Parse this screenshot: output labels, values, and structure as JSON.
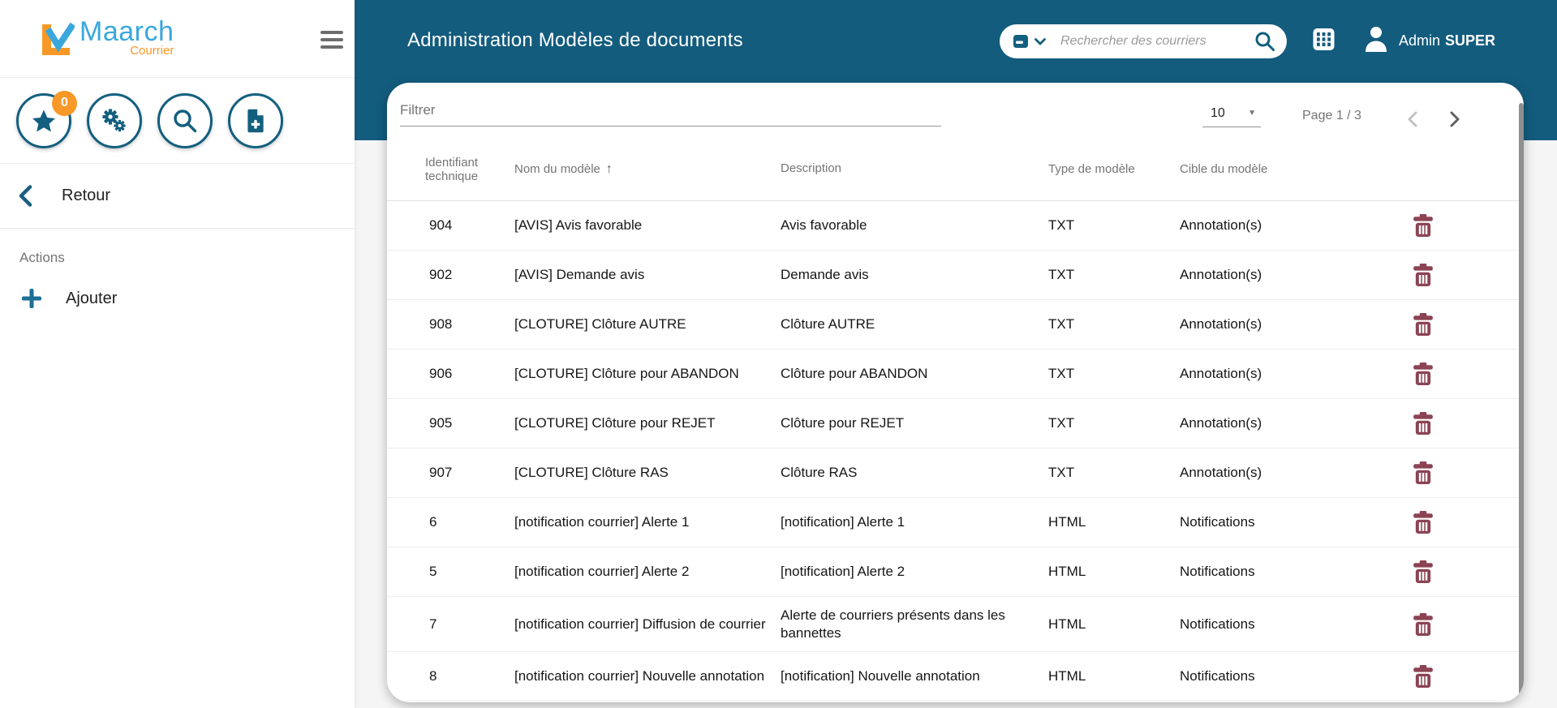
{
  "header": {
    "title": "Administration Modèles de documents",
    "search_placeholder": "Rechercher des courriers",
    "user_name": "Admin",
    "user_name_bold": "SUPER"
  },
  "sidebar": {
    "logo_text": "Maarch",
    "logo_subtext": "Courrier",
    "favorites_badge": "0",
    "back_label": "Retour",
    "actions_label": "Actions",
    "add_label": "Ajouter"
  },
  "toolbar": {
    "filter_placeholder": "Filtrer",
    "page_size": "10",
    "page_info": "Page 1 / 3"
  },
  "icons": {
    "sort_asc_glyph": "↑",
    "caret_down_glyph": "▼"
  },
  "colors": {
    "accent_teal": "#135c7e",
    "icon_teal": "#135f7f",
    "orange": "#f79827",
    "logo_blue": "#3aa7dd",
    "delete_red": "#8c4353"
  },
  "table": {
    "headers": [
      "Identifiant technique",
      "Nom du modèle",
      "Description",
      "Type de modèle",
      "Cible du modèle"
    ],
    "rows": [
      {
        "id": "904",
        "name": "[AVIS] Avis favorable",
        "description": "Avis favorable",
        "type": "TXT",
        "target": "Annotation(s)"
      },
      {
        "id": "902",
        "name": "[AVIS] Demande avis",
        "description": "Demande avis",
        "type": "TXT",
        "target": "Annotation(s)"
      },
      {
        "id": "908",
        "name": "[CLOTURE] Clôture AUTRE",
        "description": "Clôture AUTRE",
        "type": "TXT",
        "target": "Annotation(s)"
      },
      {
        "id": "906",
        "name": "[CLOTURE] Clôture pour ABANDON",
        "description": "Clôture pour ABANDON",
        "type": "TXT",
        "target": "Annotation(s)"
      },
      {
        "id": "905",
        "name": "[CLOTURE] Clôture pour REJET",
        "description": "Clôture pour REJET",
        "type": "TXT",
        "target": "Annotation(s)"
      },
      {
        "id": "907",
        "name": "[CLOTURE] Clôture RAS",
        "description": "Clôture RAS",
        "type": "TXT",
        "target": "Annotation(s)"
      },
      {
        "id": "6",
        "name": "[notification courrier] Alerte 1",
        "description": "[notification] Alerte 1",
        "type": "HTML",
        "target": "Notifications"
      },
      {
        "id": "5",
        "name": "[notification courrier] Alerte 2",
        "description": "[notification] Alerte 2",
        "type": "HTML",
        "target": "Notifications"
      },
      {
        "id": "7",
        "name": "[notification courrier] Diffusion de courrier",
        "description": "Alerte de courriers présents dans les bannettes",
        "type": "HTML",
        "target": "Notifications"
      },
      {
        "id": "8",
        "name": "[notification courrier] Nouvelle annotation",
        "description": "[notification] Nouvelle annotation",
        "type": "HTML",
        "target": "Notifications"
      }
    ]
  }
}
